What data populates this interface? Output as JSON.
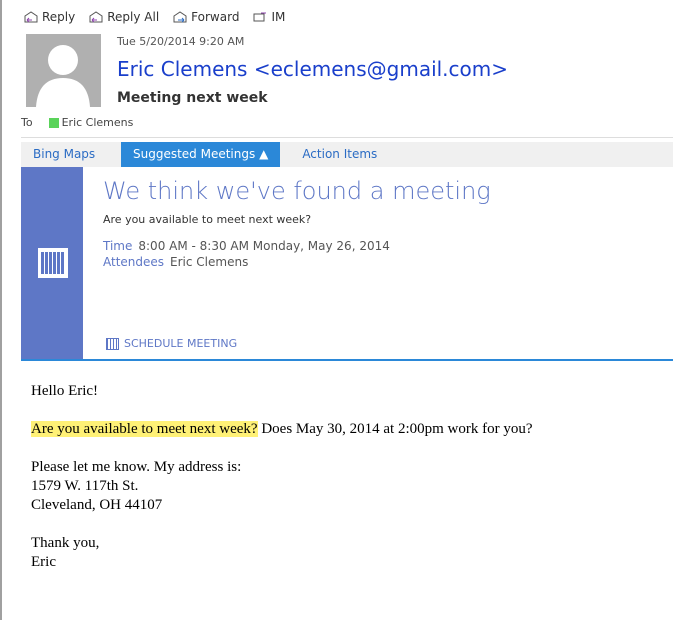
{
  "toolbar": {
    "reply": "Reply",
    "reply_all": "Reply All",
    "forward": "Forward",
    "im": "IM"
  },
  "header": {
    "date": "Tue 5/20/2014 9:20 AM",
    "from": "Eric Clemens <eclemens@gmail.com>",
    "subject": "Meeting next week",
    "to_label": "To",
    "to": "Eric Clemens"
  },
  "tabs": [
    {
      "label": "Bing Maps"
    },
    {
      "label": "Suggested Meetings",
      "active": true
    },
    {
      "label": "Action Items"
    }
  ],
  "panel": {
    "title": "We think we've found a meeting",
    "question": "Are you available to meet next week?",
    "time_label": "Time",
    "time": "8:00 AM - 8:30 AM Monday, May 26, 2014",
    "attendees_label": "Attendees",
    "attendees": "Eric Clemens",
    "schedule": "SCHEDULE MEETING"
  },
  "body": {
    "greeting": "Hello Eric!",
    "highlight": "Are you available to meet next week?",
    "rest": " Does May 30, 2014 at 2:00pm work for you?",
    "l1": "Please let me know. My address is:",
    "l2": "1579 W. 117th St.",
    "l3": "Cleveland, OH 44107",
    "l4": "Thank you,",
    "l5": "Eric"
  },
  "colors": {
    "accent": "#2b88d8",
    "panel": "#5e77c6",
    "highlight": "#fff176"
  }
}
